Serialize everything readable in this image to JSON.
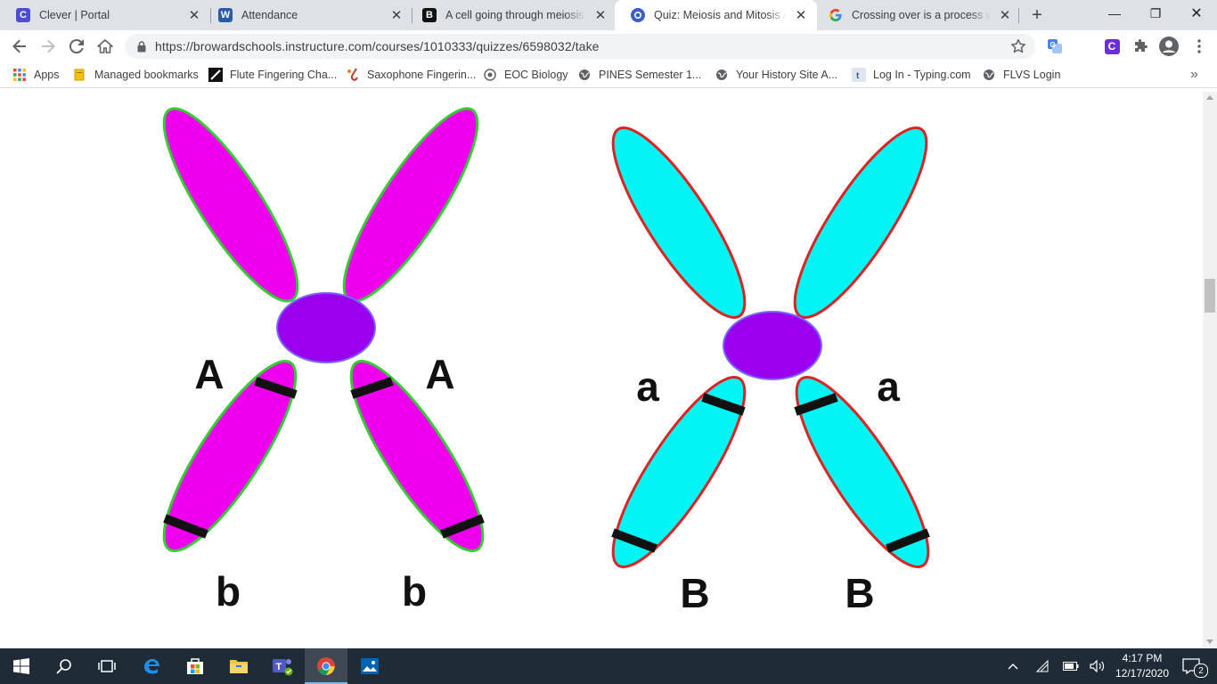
{
  "tabs": [
    {
      "title": "Clever | Portal",
      "favicon": "C",
      "favicon_color": "#4d4dd1",
      "active": false
    },
    {
      "title": "Attendance",
      "favicon": "W",
      "favicon_color": "#2a5ba8",
      "active": false
    },
    {
      "title": "A cell going through meiosis c",
      "favicon": "B",
      "favicon_color": "#111111",
      "active": false
    },
    {
      "title": "Quiz: Meiosis and Mitosis Asse",
      "favicon": "canvas",
      "favicon_color": "#3b5dc9",
      "active": true
    },
    {
      "title": "Crossing over is a process whic",
      "favicon": "G",
      "favicon_color": "#4285f4",
      "active": false
    }
  ],
  "new_tab_label": "+",
  "window_controls": {
    "minimize": "—",
    "restore": "❐",
    "close": "✕"
  },
  "toolbar": {
    "url": "https://browardschools.instructure.com/courses/1010333/quizzes/6598032/take",
    "extension_badge": "C"
  },
  "bookmarks": [
    {
      "label": "Apps",
      "icon": "apps-grid-icon"
    },
    {
      "label": "Managed bookmarks",
      "icon": "folder-icon"
    },
    {
      "label": "Flute Fingering Cha...",
      "icon": "flute-icon"
    },
    {
      "label": "Saxophone Fingerin...",
      "icon": "saxophone-icon"
    },
    {
      "label": "EOC Biology",
      "icon": "globe-icon"
    },
    {
      "label": "PINES Semester 1...",
      "icon": "globe-icon"
    },
    {
      "label": "Your History Site A...",
      "icon": "globe-icon"
    },
    {
      "label": "Log In - Typing.com",
      "icon": "typing-icon"
    },
    {
      "label": "FLVS Login",
      "icon": "globe-icon"
    }
  ],
  "bookmarks_overflow": "»",
  "figure": {
    "left_chromosome": {
      "fill": "#ee00ee",
      "outline": "#33cc33",
      "centromere": "#9900ee",
      "upper_label_left": "A",
      "upper_label_right": "A",
      "lower_label_left": "b",
      "lower_label_right": "b"
    },
    "right_chromosome": {
      "fill": "#00f5f5",
      "outline": "#dd2222",
      "centromere": "#9900ee",
      "upper_label_left": "a",
      "upper_label_right": "a",
      "lower_label_left": "B",
      "lower_label_right": "B"
    }
  },
  "taskbar": {
    "time": "4:17 PM",
    "date": "12/17/2020",
    "notifications": "2",
    "apps": [
      "start-icon",
      "search-icon",
      "task-view-icon",
      "edge-icon",
      "store-icon",
      "file-explorer-icon",
      "teams-icon",
      "chrome-icon",
      "photos-icon"
    ],
    "active_app": "chrome-icon"
  }
}
